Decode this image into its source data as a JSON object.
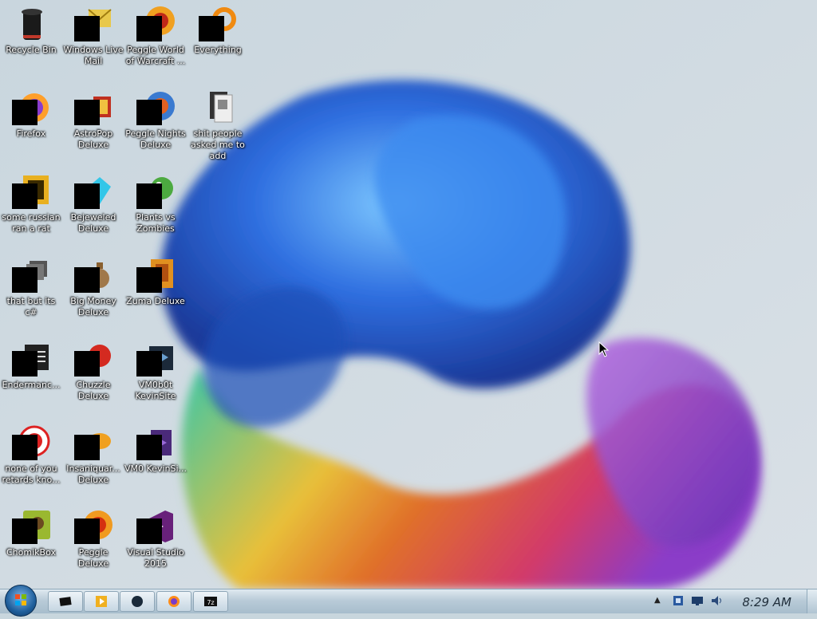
{
  "desktop": {
    "icons": [
      {
        "label": "Recycle Bin"
      },
      {
        "label": "Windows Live Mail"
      },
      {
        "label": "Peggle World of Warcraft ..."
      },
      {
        "label": "Everything"
      },
      {
        "label": "Firefox"
      },
      {
        "label": "AstroPop Deluxe"
      },
      {
        "label": "Peggle Nights Deluxe"
      },
      {
        "label": "shit people asked me to add"
      },
      {
        "label": "some russian ran a rat"
      },
      {
        "label": "Bejeweled Deluxe"
      },
      {
        "label": "Plants vs Zombies"
      },
      {
        "label": "that but its c#"
      },
      {
        "label": "Big Money Deluxe"
      },
      {
        "label": "Zuma Deluxe"
      },
      {
        "label": "Endermanc..."
      },
      {
        "label": "Chuzzle Deluxe"
      },
      {
        "label": "VM0b0t KevinSite"
      },
      {
        "label": "none of you retards kno..."
      },
      {
        "label": "Insaniquar... Deluxe"
      },
      {
        "label": "VM0 KevinSi..."
      },
      {
        "label": "ChomikBox"
      },
      {
        "label": "Peggle Deluxe"
      },
      {
        "label": "Visual Studio 2015"
      }
    ]
  },
  "taskbar": {
    "buttons": [
      {
        "icon": "app-icon"
      },
      {
        "icon": "media-player-icon"
      },
      {
        "icon": "circle-app-icon"
      },
      {
        "icon": "firefox-icon"
      },
      {
        "icon": "7zip-icon",
        "label": "7z"
      }
    ],
    "tray": {
      "chevron": "▲",
      "icons": [
        "network-icon",
        "monitor-icon",
        "volume-icon"
      ]
    },
    "clock": "8:29 AM"
  }
}
